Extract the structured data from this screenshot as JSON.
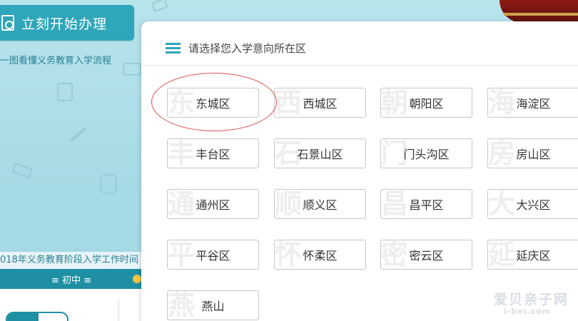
{
  "sidebar": {
    "start_button": "立刻开始办理",
    "flow_link": "一图看懂义务教育入学流程",
    "notice": "018年义务教育阶段入学工作时间",
    "grade_tab": "≡ 初中 ≡"
  },
  "dialog": {
    "prompt": "请选择您入学意向所在区",
    "districts": [
      {
        "label": "东城区",
        "wm": "东"
      },
      {
        "label": "西城区",
        "wm": "西"
      },
      {
        "label": "朝阳区",
        "wm": "朝"
      },
      {
        "label": "海淀区",
        "wm": "海"
      },
      {
        "label": "丰台区",
        "wm": "丰"
      },
      {
        "label": "石景山区",
        "wm": "石"
      },
      {
        "label": "门头沟区",
        "wm": "门"
      },
      {
        "label": "房山区",
        "wm": "房"
      },
      {
        "label": "通州区",
        "wm": "通"
      },
      {
        "label": "顺义区",
        "wm": "顺"
      },
      {
        "label": "昌平区",
        "wm": "昌"
      },
      {
        "label": "大兴区",
        "wm": "大"
      },
      {
        "label": "平谷区",
        "wm": "平"
      },
      {
        "label": "怀柔区",
        "wm": "怀"
      },
      {
        "label": "密云区",
        "wm": "密"
      },
      {
        "label": "延庆区",
        "wm": "延"
      },
      {
        "label": "燕山",
        "wm": "燕"
      }
    ]
  },
  "watermark": {
    "line1": "爱贝亲子网",
    "line2": "i-bei.com"
  },
  "colors": {
    "accent": "#2fa6b9",
    "annotation": "#d9534f"
  }
}
